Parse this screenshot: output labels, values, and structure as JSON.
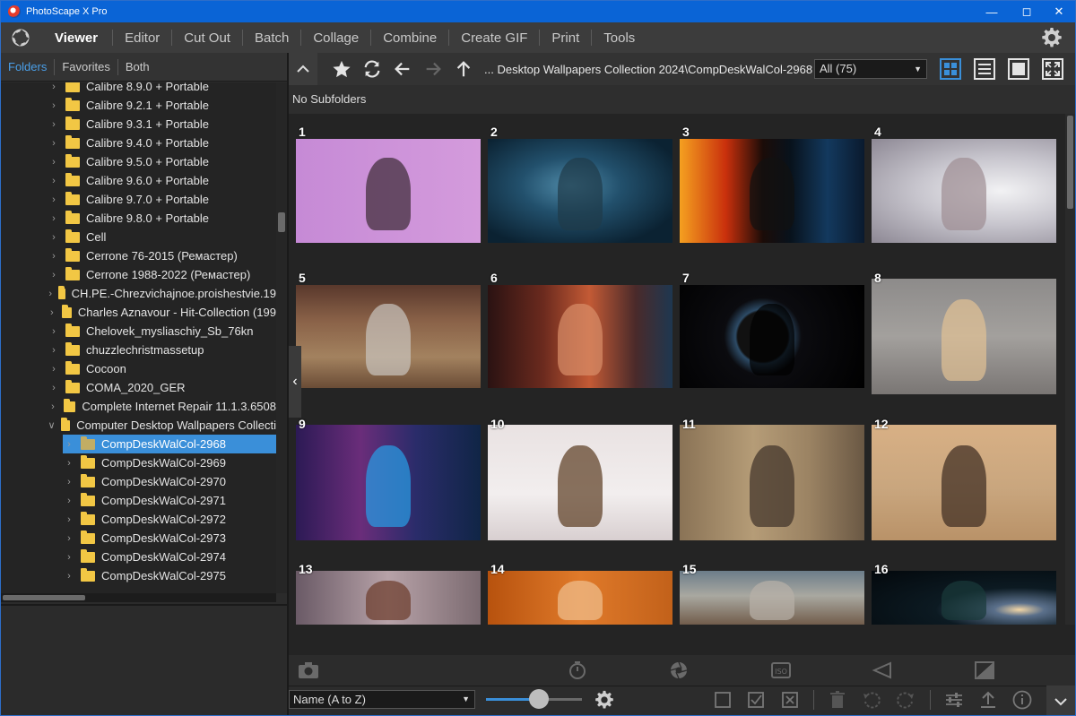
{
  "window": {
    "title": "PhotoScape X Pro"
  },
  "menu": {
    "items": [
      "Viewer",
      "Editor",
      "Cut Out",
      "Batch",
      "Collage",
      "Combine",
      "Create GIF",
      "Print",
      "Tools"
    ],
    "active": "Viewer"
  },
  "left_tabs": [
    "Folders",
    "Favorites",
    "Both"
  ],
  "left_tabs_active": "Folders",
  "tree": [
    {
      "label": "Calibre 8.9.0 + Portable",
      "level": 0,
      "expanded": false
    },
    {
      "label": "Calibre 9.2.1 + Portable",
      "level": 0,
      "expanded": false
    },
    {
      "label": "Calibre 9.3.1 + Portable",
      "level": 0,
      "expanded": false
    },
    {
      "label": "Calibre 9.4.0 + Portable",
      "level": 0,
      "expanded": false
    },
    {
      "label": "Calibre 9.5.0 + Portable",
      "level": 0,
      "expanded": false
    },
    {
      "label": "Calibre 9.6.0 + Portable",
      "level": 0,
      "expanded": false
    },
    {
      "label": "Calibre 9.7.0 + Portable",
      "level": 0,
      "expanded": false
    },
    {
      "label": "Calibre 9.8.0 + Portable",
      "level": 0,
      "expanded": false
    },
    {
      "label": "Cell",
      "level": 0,
      "expanded": false
    },
    {
      "label": "Cerrone 76-2015 (Ремастер)",
      "level": 0,
      "expanded": false
    },
    {
      "label": "Cerrone 1988-2022 (Ремастер)",
      "level": 0,
      "expanded": false
    },
    {
      "label": "CH.PE.-Chrezvichajnoe.proishestvie.19",
      "level": 0,
      "expanded": false
    },
    {
      "label": "Charles Aznavour - Hit-Collection (199",
      "level": 0,
      "expanded": false
    },
    {
      "label": "Chelovek_mysliaschiy_Sb_76kn",
      "level": 0,
      "expanded": false
    },
    {
      "label": "chuzzlechristmassetup",
      "level": 0,
      "expanded": false
    },
    {
      "label": "Cocoon",
      "level": 0,
      "expanded": false
    },
    {
      "label": "COMA_2020_GER",
      "level": 0,
      "expanded": false
    },
    {
      "label": "Complete Internet Repair 11.1.3.6508",
      "level": 0,
      "expanded": false
    },
    {
      "label": "Computer Desktop Wallpapers Collecti",
      "level": 0,
      "expanded": true
    },
    {
      "label": "CompDeskWalCol-2968",
      "level": 1,
      "expanded": false,
      "selected": true
    },
    {
      "label": "CompDeskWalCol-2969",
      "level": 1,
      "expanded": false
    },
    {
      "label": "CompDeskWalCol-2970",
      "level": 1,
      "expanded": false
    },
    {
      "label": "CompDeskWalCol-2971",
      "level": 1,
      "expanded": false
    },
    {
      "label": "CompDeskWalCol-2972",
      "level": 1,
      "expanded": false
    },
    {
      "label": "CompDeskWalCol-2973",
      "level": 1,
      "expanded": false
    },
    {
      "label": "CompDeskWalCol-2974",
      "level": 1,
      "expanded": false
    },
    {
      "label": "CompDeskWalCol-2975",
      "level": 1,
      "expanded": false
    }
  ],
  "toolbar": {
    "path": "... Desktop Wallpapers Collection 2024\\CompDeskWalCol-2968",
    "filter": "All (75)",
    "subfolder_text": "No Subfolders"
  },
  "thumbnails": [
    {
      "n": "1",
      "bg": "linear-gradient(90deg,#c68ad6,#d49bdc)",
      "fg": "#3a2a33"
    },
    {
      "n": "2",
      "bg": "radial-gradient(ellipse at 45% 45%,#4f8aa8 0,#22506c 35%,#0b2232 80%)",
      "fg": "#203a48"
    },
    {
      "n": "3",
      "bg": "linear-gradient(90deg,#f5a020 0%,#c9300c 25%,#1b0c08 45%,#08121c 60%,#13395e 80%,#0a1a2e 100%)",
      "fg": "#111"
    },
    {
      "n": "4",
      "bg": "radial-gradient(ellipse at 70% 50%,#f2f2f4 0,#c8c6ce 45%,#8d8894 100%)",
      "fg": "#9e8d93"
    },
    {
      "n": "5",
      "bg": "linear-gradient(180deg,#59382c 0%,#8a6248 35%,#a3825f 70%,#6a4c36 100%)",
      "fg": "#c9c5bf"
    },
    {
      "n": "6",
      "bg": "linear-gradient(90deg,#2a1212 0%,#6b2a1e 30%,#c35a35 55%,#4a2a2a 80%,#1e3750 100%)",
      "fg": "#d98f6a"
    },
    {
      "n": "7",
      "bg": "radial-gradient(circle at 45% 50%,#111 0 22%,#2d4b66 24%,#0b0b0f 34%,#000 100%)",
      "fg": "#000"
    },
    {
      "n": "8",
      "bg": "linear-gradient(180deg,#8d8b8a 0%,#a3a09d 50%,#7a7674 100%)",
      "fg": "#e2c294"
    },
    {
      "n": "9",
      "bg": "linear-gradient(90deg,#2c1a55 0%,#6a2d7a 35%,#2a2c6a 65%,#102546 100%)",
      "fg": "#27a0e8"
    },
    {
      "n": "10",
      "bg": "linear-gradient(180deg,#e9e2e2 0%,#f2eeee 60%,#d8cfd0 100%)",
      "fg": "#5a3a20"
    },
    {
      "n": "11",
      "bg": "linear-gradient(90deg,#8a7356 0%,#b59c77 40%,#9b8363 70%,#6a5844 100%)",
      "fg": "#3d3028"
    },
    {
      "n": "12",
      "bg": "linear-gradient(180deg,#d8b085 0%,#c9a67e 55%,#b99268 100%)",
      "fg": "#3a2a20"
    },
    {
      "n": "13",
      "bg": "linear-gradient(90deg,#6a5a66 0%,#b7a2a8 50%,#7b6a70 100%)",
      "fg": "#6b3b2a"
    },
    {
      "n": "14",
      "bg": "linear-gradient(90deg,#b7520e 0%,#e07a2a 50%,#c2611a 100%)",
      "fg": "#f0c090"
    },
    {
      "n": "15",
      "bg": "linear-gradient(180deg,#6c7d8a 0%,#a9a8a0 45%,#6e5846 100%)",
      "fg": "#b8b0a8"
    },
    {
      "n": "16",
      "bg": "radial-gradient(ellipse at 80% 70%,#f4d7a6 0,#5a6f8a 12%,#0c1a22 40%,#03080c 100%)",
      "fg": "#1a3a3a"
    }
  ],
  "bottom": {
    "sort": "Name (A to Z)",
    "thumb_size_level": 0.55
  }
}
